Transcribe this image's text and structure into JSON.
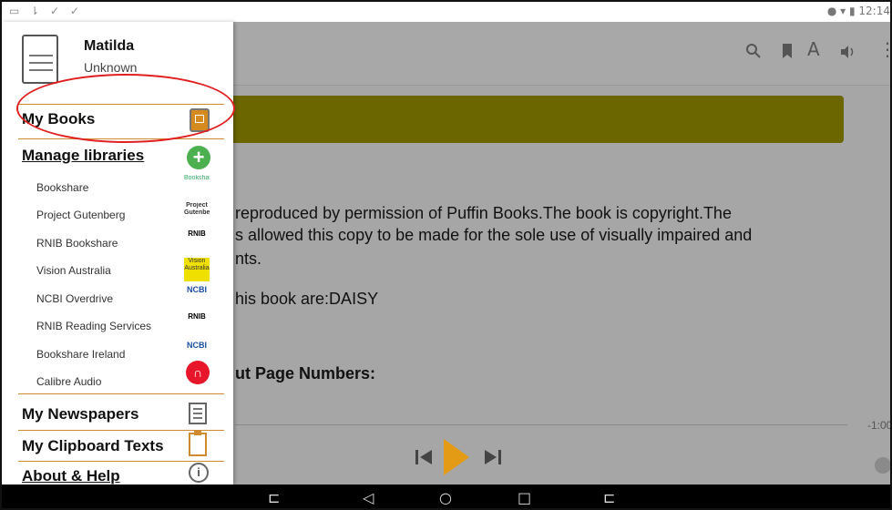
{
  "status": {
    "left_icons": "▭ ⇂ ✓ ✓",
    "right": "● ▾ ▮ 12:14"
  },
  "toolbar": {
    "search_icon": "search-icon",
    "bookmark_icon": "bookmark-icon",
    "font_icon": "A",
    "volume_icon": "volume-icon",
    "more_icon": "⋮"
  },
  "reader": {
    "lines": [
      "reproduced by permission of Puffin Books.The book is copyright.The",
      "s allowed this copy to be made for the sole use of visually impaired and",
      "nts.",
      "his book are:DAISY",
      "ut Page Numbers:"
    ],
    "time": "-1:00"
  },
  "drawer": {
    "user_name": "Matilda",
    "user_sub": "Unknown",
    "my_books": "My Books",
    "manage_libraries": "Manage libraries",
    "libraries": [
      {
        "label": "Bookshare",
        "logo": "Bookshare"
      },
      {
        "label": "Project Gutenberg",
        "logo": "Project Gutenberg"
      },
      {
        "label": "RNIB Bookshare",
        "logo": "RNIB"
      },
      {
        "label": "Vision Australia",
        "logo": "Vision Australia"
      },
      {
        "label": "NCBI Overdrive",
        "logo": "NCBI"
      },
      {
        "label": "RNIB Reading Services",
        "logo": "RNIB"
      },
      {
        "label": "Bookshare Ireland",
        "logo": "NCBI"
      },
      {
        "label": "Calibre Audio",
        "logo": ""
      }
    ],
    "my_newspapers": "My Newspapers",
    "my_clipboard": "My Clipboard Texts",
    "about_help": "About & Help"
  },
  "navbar": {
    "nav1": "⊏",
    "back": "◁",
    "home": "○",
    "recents": "□",
    "nav5": "⊏"
  },
  "colors": {
    "accent": "#d08b30",
    "banner": "#6b6600",
    "highlight_circle": "#e02020",
    "play": "#e39a14"
  }
}
